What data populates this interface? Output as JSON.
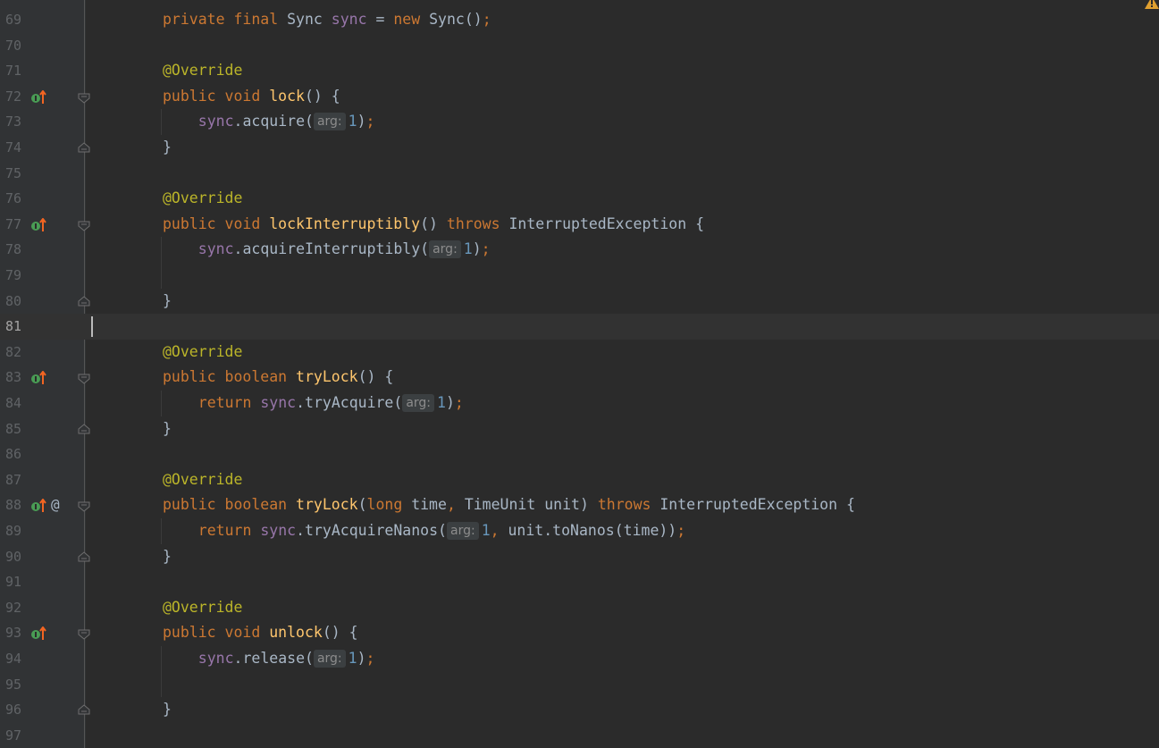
{
  "editor": {
    "lines": [
      {
        "n": "69",
        "segments": [
          [
            "kw",
            "private "
          ],
          [
            "kw",
            "final "
          ],
          [
            "plain",
            "Sync "
          ],
          [
            "fld",
            "sync"
          ],
          [
            "plain",
            " = "
          ],
          [
            "kw",
            "new "
          ],
          [
            "plain",
            "Sync()"
          ],
          [
            "kw",
            ";"
          ]
        ]
      },
      {
        "n": "70",
        "segments": []
      },
      {
        "n": "71",
        "segments": [
          [
            "an",
            "@Override"
          ]
        ]
      },
      {
        "n": "72",
        "impl": true,
        "fold": "start",
        "segments": [
          [
            "kw",
            "public "
          ],
          [
            "kw",
            "void "
          ],
          [
            "fn",
            "lock"
          ],
          [
            "plain",
            "() {"
          ]
        ]
      },
      {
        "n": "73",
        "guide": true,
        "segments": [
          [
            "fld",
            "sync"
          ],
          [
            "plain",
            ".acquire("
          ],
          [
            "hint",
            "arg:"
          ],
          [
            "num",
            "1"
          ],
          [
            "plain",
            ")"
          ],
          [
            "kw",
            ";"
          ]
        ]
      },
      {
        "n": "74",
        "fold": "end",
        "segments": [
          [
            "plain",
            "}"
          ]
        ]
      },
      {
        "n": "75",
        "segments": []
      },
      {
        "n": "76",
        "segments": [
          [
            "an",
            "@Override"
          ]
        ]
      },
      {
        "n": "77",
        "impl": true,
        "fold": "start",
        "segments": [
          [
            "kw",
            "public "
          ],
          [
            "kw",
            "void "
          ],
          [
            "fn",
            "lockInterruptibly"
          ],
          [
            "plain",
            "() "
          ],
          [
            "kw",
            "throws "
          ],
          [
            "plain",
            "InterruptedException {"
          ]
        ]
      },
      {
        "n": "78",
        "guide": true,
        "segments": [
          [
            "fld",
            "sync"
          ],
          [
            "plain",
            ".acquireInterruptibly("
          ],
          [
            "hint",
            "arg:"
          ],
          [
            "num",
            "1"
          ],
          [
            "plain",
            ")"
          ],
          [
            "kw",
            ";"
          ]
        ]
      },
      {
        "n": "79",
        "guide": true,
        "segments": []
      },
      {
        "n": "80",
        "fold": "end",
        "segments": [
          [
            "plain",
            "}"
          ]
        ]
      },
      {
        "n": "81",
        "current": true,
        "segments": []
      },
      {
        "n": "82",
        "segments": [
          [
            "an",
            "@Override"
          ]
        ]
      },
      {
        "n": "83",
        "impl": true,
        "fold": "start",
        "segments": [
          [
            "kw",
            "public "
          ],
          [
            "kw",
            "boolean "
          ],
          [
            "fn",
            "tryLock"
          ],
          [
            "plain",
            "() {"
          ]
        ]
      },
      {
        "n": "84",
        "guide": true,
        "segments": [
          [
            "kw",
            "return "
          ],
          [
            "fld",
            "sync"
          ],
          [
            "plain",
            ".tryAcquire("
          ],
          [
            "hint",
            "arg:"
          ],
          [
            "num",
            "1"
          ],
          [
            "plain",
            ")"
          ],
          [
            "kw",
            ";"
          ]
        ]
      },
      {
        "n": "85",
        "fold": "end",
        "segments": [
          [
            "plain",
            "}"
          ]
        ]
      },
      {
        "n": "86",
        "segments": []
      },
      {
        "n": "87",
        "segments": [
          [
            "an",
            "@Override"
          ]
        ]
      },
      {
        "n": "88",
        "impl": true,
        "at": "@",
        "fold": "start",
        "segments": [
          [
            "kw",
            "public "
          ],
          [
            "kw",
            "boolean "
          ],
          [
            "fn",
            "tryLock"
          ],
          [
            "plain",
            "("
          ],
          [
            "kw",
            "long "
          ],
          [
            "plain",
            "time"
          ],
          [
            "kw",
            ", "
          ],
          [
            "plain",
            "TimeUnit unit) "
          ],
          [
            "kw",
            "throws "
          ],
          [
            "plain",
            "InterruptedException {"
          ]
        ]
      },
      {
        "n": "89",
        "guide": true,
        "segments": [
          [
            "kw",
            "return "
          ],
          [
            "fld",
            "sync"
          ],
          [
            "plain",
            ".tryAcquireNanos("
          ],
          [
            "hint",
            "arg:"
          ],
          [
            "num",
            "1"
          ],
          [
            "kw",
            ", "
          ],
          [
            "plain",
            "unit.toNanos(time))"
          ],
          [
            "kw",
            ";"
          ]
        ]
      },
      {
        "n": "90",
        "fold": "end",
        "segments": [
          [
            "plain",
            "}"
          ]
        ]
      },
      {
        "n": "91",
        "segments": []
      },
      {
        "n": "92",
        "segments": [
          [
            "an",
            "@Override"
          ]
        ]
      },
      {
        "n": "93",
        "impl": true,
        "fold": "start",
        "segments": [
          [
            "kw",
            "public "
          ],
          [
            "kw",
            "void "
          ],
          [
            "fn",
            "unlock"
          ],
          [
            "plain",
            "() {"
          ]
        ]
      },
      {
        "n": "94",
        "guide": true,
        "segments": [
          [
            "fld",
            "sync"
          ],
          [
            "plain",
            ".release("
          ],
          [
            "hint",
            "arg:"
          ],
          [
            "num",
            "1"
          ],
          [
            "plain",
            ")"
          ],
          [
            "kw",
            ";"
          ]
        ]
      },
      {
        "n": "95",
        "guide": true,
        "segments": []
      },
      {
        "n": "96",
        "fold": "end",
        "segments": [
          [
            "plain",
            "}"
          ]
        ]
      },
      {
        "n": "97",
        "segments": []
      }
    ],
    "indent_levels": {
      "69": 2,
      "71": 2,
      "72": 2,
      "73": 3,
      "74": 2,
      "76": 2,
      "77": 2,
      "78": 3,
      "80": 2,
      "82": 2,
      "83": 2,
      "84": 3,
      "85": 2,
      "87": 2,
      "88": 2,
      "89": 3,
      "90": 2,
      "92": 2,
      "93": 2,
      "94": 3,
      "96": 2
    }
  },
  "colors": {
    "background": "#2b2b2b",
    "gutter": "#313335",
    "keyword": "#cc7832",
    "annotation": "#bbb529",
    "method": "#ffc66d",
    "field": "#9876aa",
    "number": "#6897bb",
    "text": "#a9b7c6",
    "impl_icon": "#499c54",
    "impl_arrow": "#f26522",
    "warning": "#e0a030"
  },
  "icons": {
    "implements": "implements-method-icon",
    "fold": "fold-marker-icon",
    "warning": "warning-icon",
    "at": "annotation-at-icon"
  }
}
